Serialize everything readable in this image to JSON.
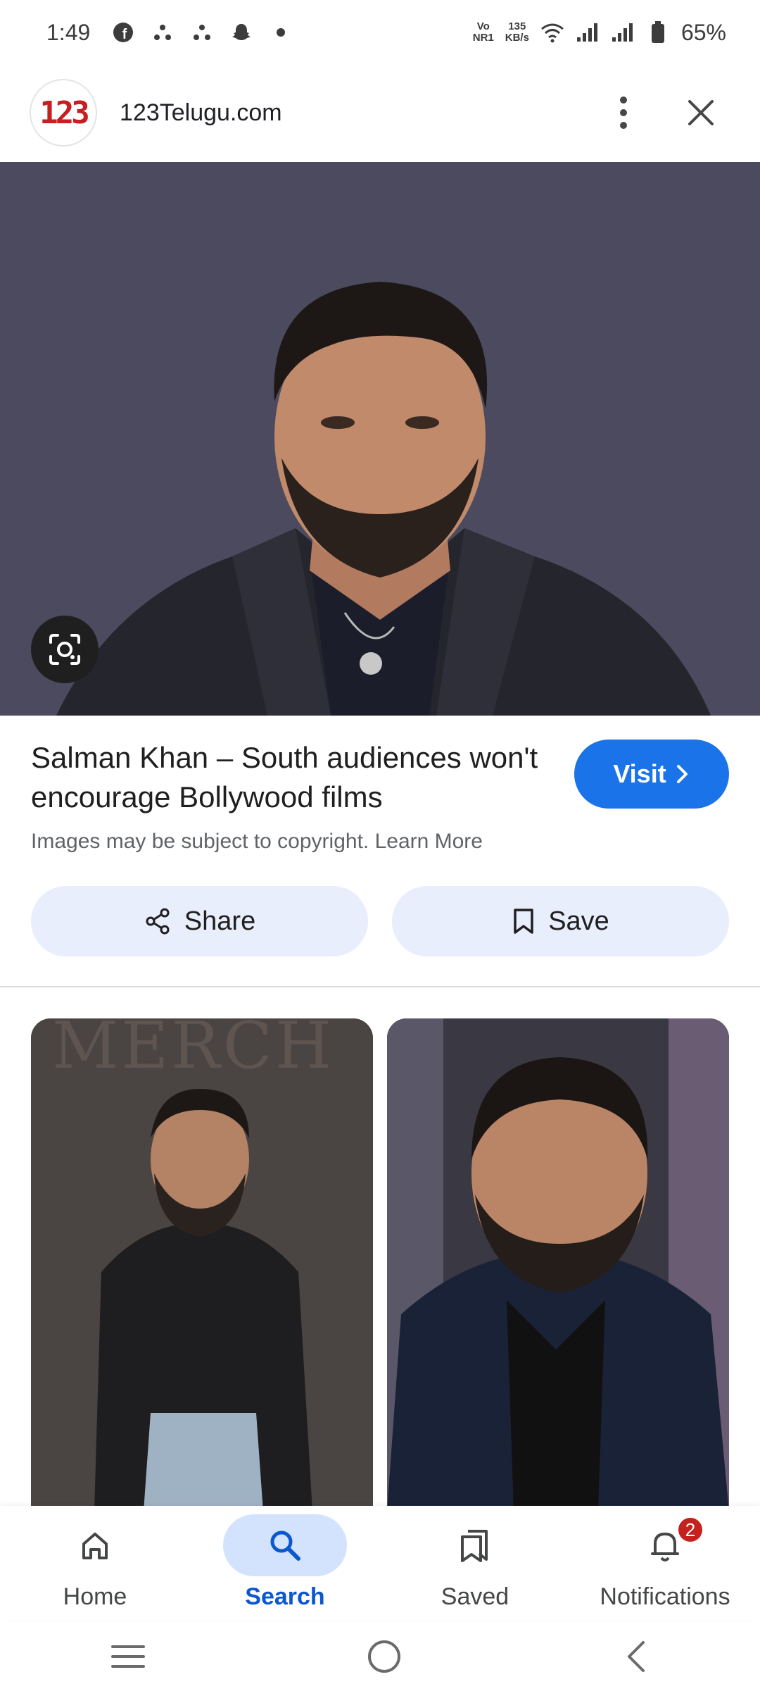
{
  "status_bar": {
    "time": "1:49",
    "network_type_top": "Vo",
    "network_type_bottom": "NR1",
    "speed_value": "135",
    "speed_unit": "KB/s",
    "battery": "65%"
  },
  "app_bar": {
    "site_logo_text": "123",
    "site_name": "123Telugu.com"
  },
  "result": {
    "title": "Salman Khan – South audiences won't encourage Bollywood films",
    "copyright_text": "Images may be subject to copyright. Learn More",
    "visit_label": "Visit"
  },
  "actions": {
    "share_label": "Share",
    "save_label": "Save"
  },
  "grid": {
    "left_image_backdrop_text": "MERCH"
  },
  "bottom_nav": {
    "items": [
      {
        "label": "Home",
        "icon": "home-icon"
      },
      {
        "label": "Search",
        "icon": "search-icon",
        "active": true
      },
      {
        "label": "Saved",
        "icon": "saved-icon"
      },
      {
        "label": "Notifications",
        "icon": "bell-icon",
        "badge": "2"
      }
    ]
  },
  "colors": {
    "accent": "#1a73e8",
    "active_nav": "#0b57d0",
    "badge": "#c5221f",
    "action_bg": "#e8eefb"
  }
}
